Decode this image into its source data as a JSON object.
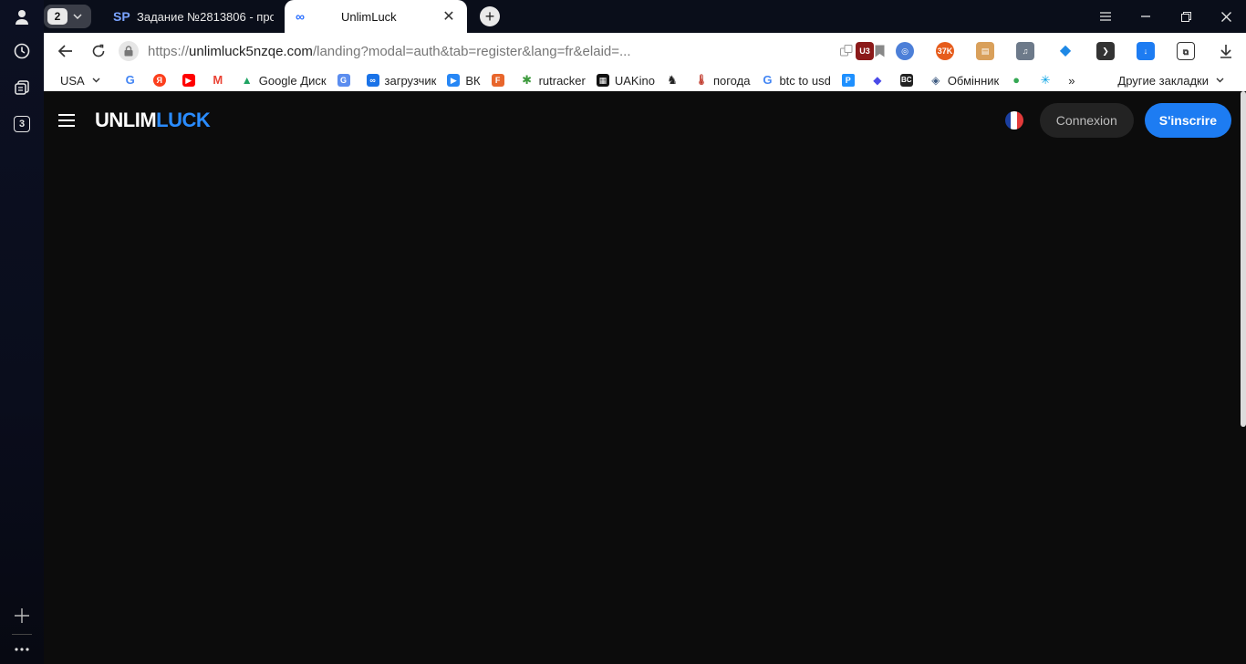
{
  "browser": {
    "tab_group_count": "2",
    "tabs": [
      {
        "favicon": "SP",
        "title": "Задание №2813806 - прос",
        "active": false
      },
      {
        "favicon": "∞",
        "title": "UnlimLuck",
        "active": true
      }
    ],
    "url_host": "unlimluck5nzqe.com",
    "url_prefix": "https://",
    "url_path": "/landing?modal=auth&tab=register&lang=fr&elaid=...",
    "rail_tabs_count": "3",
    "bookmarks": [
      {
        "label": "USA",
        "icon": "dropdown",
        "color": "#ffffff"
      },
      {
        "label": "",
        "icon": "G",
        "color": "#4285f4"
      },
      {
        "label": "",
        "icon": "Я",
        "color": "#fc3f1d"
      },
      {
        "label": "",
        "icon": "▶",
        "color": "#ff0000"
      },
      {
        "label": "",
        "icon": "M",
        "color": "#ea4335"
      },
      {
        "label": "Google Диск",
        "icon": "▲",
        "color": "#1fa463"
      },
      {
        "label": "",
        "icon": "G",
        "color": "#5b8def"
      },
      {
        "label": "загрузчик",
        "icon": "∞",
        "color": "#1a73e8"
      },
      {
        "label": "ВК",
        "icon": "▶",
        "color": "#2787f5"
      },
      {
        "label": "",
        "icon": "F",
        "color": "#e8662c"
      },
      {
        "label": "rutracker",
        "icon": "✱",
        "color": "#3c9a3c"
      },
      {
        "label": "UAKino",
        "icon": "▦",
        "color": "#111111"
      },
      {
        "label": "",
        "icon": "♞",
        "color": "#222222"
      },
      {
        "label": "погода",
        "icon": "🌡",
        "color": "#c0392b"
      },
      {
        "label": "btc to usd",
        "icon": "G",
        "color": "#4285f4"
      },
      {
        "label": "",
        "icon": "P",
        "color": "#1e90ff"
      },
      {
        "label": "",
        "icon": "◆",
        "color": "#4a4ae8"
      },
      {
        "label": "",
        "icon": "BC",
        "color": "#222222"
      },
      {
        "label": "Обмінник",
        "icon": "◈",
        "color": "#3d5a80"
      },
      {
        "label": "",
        "icon": "●",
        "color": "#34a853"
      },
      {
        "label": "",
        "icon": "✳",
        "color": "#00a0e3"
      }
    ],
    "bookmarks_more": "»",
    "other_bookmarks": "Другие закладки"
  },
  "site": {
    "logo_main": "UNLIM",
    "logo_accent": "LUCK",
    "login_label": "Connexion",
    "register_label": "S'inscrire",
    "accent_color": "#1d7cf2"
  }
}
